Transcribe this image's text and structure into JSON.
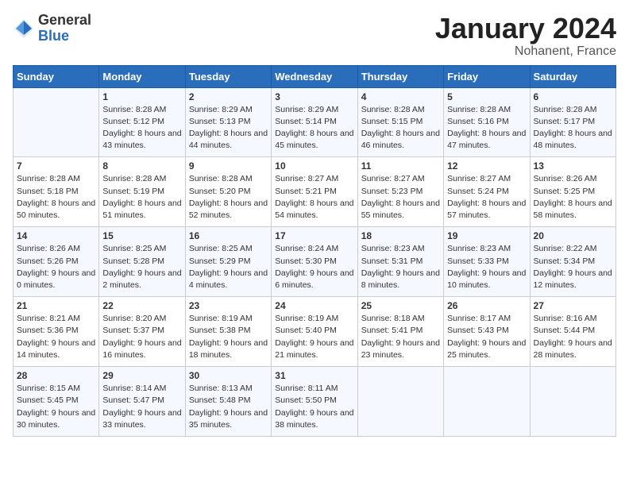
{
  "header": {
    "logo_general": "General",
    "logo_blue": "Blue",
    "month_title": "January 2024",
    "location": "Nohanent, France"
  },
  "days_of_week": [
    "Sunday",
    "Monday",
    "Tuesday",
    "Wednesday",
    "Thursday",
    "Friday",
    "Saturday"
  ],
  "weeks": [
    [
      {
        "day": "",
        "sunrise": "",
        "sunset": "",
        "daylight": ""
      },
      {
        "day": "1",
        "sunrise": "Sunrise: 8:28 AM",
        "sunset": "Sunset: 5:12 PM",
        "daylight": "Daylight: 8 hours and 43 minutes."
      },
      {
        "day": "2",
        "sunrise": "Sunrise: 8:29 AM",
        "sunset": "Sunset: 5:13 PM",
        "daylight": "Daylight: 8 hours and 44 minutes."
      },
      {
        "day": "3",
        "sunrise": "Sunrise: 8:29 AM",
        "sunset": "Sunset: 5:14 PM",
        "daylight": "Daylight: 8 hours and 45 minutes."
      },
      {
        "day": "4",
        "sunrise": "Sunrise: 8:28 AM",
        "sunset": "Sunset: 5:15 PM",
        "daylight": "Daylight: 8 hours and 46 minutes."
      },
      {
        "day": "5",
        "sunrise": "Sunrise: 8:28 AM",
        "sunset": "Sunset: 5:16 PM",
        "daylight": "Daylight: 8 hours and 47 minutes."
      },
      {
        "day": "6",
        "sunrise": "Sunrise: 8:28 AM",
        "sunset": "Sunset: 5:17 PM",
        "daylight": "Daylight: 8 hours and 48 minutes."
      }
    ],
    [
      {
        "day": "7",
        "sunrise": "Sunrise: 8:28 AM",
        "sunset": "Sunset: 5:18 PM",
        "daylight": "Daylight: 8 hours and 50 minutes."
      },
      {
        "day": "8",
        "sunrise": "Sunrise: 8:28 AM",
        "sunset": "Sunset: 5:19 PM",
        "daylight": "Daylight: 8 hours and 51 minutes."
      },
      {
        "day": "9",
        "sunrise": "Sunrise: 8:28 AM",
        "sunset": "Sunset: 5:20 PM",
        "daylight": "Daylight: 8 hours and 52 minutes."
      },
      {
        "day": "10",
        "sunrise": "Sunrise: 8:27 AM",
        "sunset": "Sunset: 5:21 PM",
        "daylight": "Daylight: 8 hours and 54 minutes."
      },
      {
        "day": "11",
        "sunrise": "Sunrise: 8:27 AM",
        "sunset": "Sunset: 5:23 PM",
        "daylight": "Daylight: 8 hours and 55 minutes."
      },
      {
        "day": "12",
        "sunrise": "Sunrise: 8:27 AM",
        "sunset": "Sunset: 5:24 PM",
        "daylight": "Daylight: 8 hours and 57 minutes."
      },
      {
        "day": "13",
        "sunrise": "Sunrise: 8:26 AM",
        "sunset": "Sunset: 5:25 PM",
        "daylight": "Daylight: 8 hours and 58 minutes."
      }
    ],
    [
      {
        "day": "14",
        "sunrise": "Sunrise: 8:26 AM",
        "sunset": "Sunset: 5:26 PM",
        "daylight": "Daylight: 9 hours and 0 minutes."
      },
      {
        "day": "15",
        "sunrise": "Sunrise: 8:25 AM",
        "sunset": "Sunset: 5:28 PM",
        "daylight": "Daylight: 9 hours and 2 minutes."
      },
      {
        "day": "16",
        "sunrise": "Sunrise: 8:25 AM",
        "sunset": "Sunset: 5:29 PM",
        "daylight": "Daylight: 9 hours and 4 minutes."
      },
      {
        "day": "17",
        "sunrise": "Sunrise: 8:24 AM",
        "sunset": "Sunset: 5:30 PM",
        "daylight": "Daylight: 9 hours and 6 minutes."
      },
      {
        "day": "18",
        "sunrise": "Sunrise: 8:23 AM",
        "sunset": "Sunset: 5:31 PM",
        "daylight": "Daylight: 9 hours and 8 minutes."
      },
      {
        "day": "19",
        "sunrise": "Sunrise: 8:23 AM",
        "sunset": "Sunset: 5:33 PM",
        "daylight": "Daylight: 9 hours and 10 minutes."
      },
      {
        "day": "20",
        "sunrise": "Sunrise: 8:22 AM",
        "sunset": "Sunset: 5:34 PM",
        "daylight": "Daylight: 9 hours and 12 minutes."
      }
    ],
    [
      {
        "day": "21",
        "sunrise": "Sunrise: 8:21 AM",
        "sunset": "Sunset: 5:36 PM",
        "daylight": "Daylight: 9 hours and 14 minutes."
      },
      {
        "day": "22",
        "sunrise": "Sunrise: 8:20 AM",
        "sunset": "Sunset: 5:37 PM",
        "daylight": "Daylight: 9 hours and 16 minutes."
      },
      {
        "day": "23",
        "sunrise": "Sunrise: 8:19 AM",
        "sunset": "Sunset: 5:38 PM",
        "daylight": "Daylight: 9 hours and 18 minutes."
      },
      {
        "day": "24",
        "sunrise": "Sunrise: 8:19 AM",
        "sunset": "Sunset: 5:40 PM",
        "daylight": "Daylight: 9 hours and 21 minutes."
      },
      {
        "day": "25",
        "sunrise": "Sunrise: 8:18 AM",
        "sunset": "Sunset: 5:41 PM",
        "daylight": "Daylight: 9 hours and 23 minutes."
      },
      {
        "day": "26",
        "sunrise": "Sunrise: 8:17 AM",
        "sunset": "Sunset: 5:43 PM",
        "daylight": "Daylight: 9 hours and 25 minutes."
      },
      {
        "day": "27",
        "sunrise": "Sunrise: 8:16 AM",
        "sunset": "Sunset: 5:44 PM",
        "daylight": "Daylight: 9 hours and 28 minutes."
      }
    ],
    [
      {
        "day": "28",
        "sunrise": "Sunrise: 8:15 AM",
        "sunset": "Sunset: 5:45 PM",
        "daylight": "Daylight: 9 hours and 30 minutes."
      },
      {
        "day": "29",
        "sunrise": "Sunrise: 8:14 AM",
        "sunset": "Sunset: 5:47 PM",
        "daylight": "Daylight: 9 hours and 33 minutes."
      },
      {
        "day": "30",
        "sunrise": "Sunrise: 8:13 AM",
        "sunset": "Sunset: 5:48 PM",
        "daylight": "Daylight: 9 hours and 35 minutes."
      },
      {
        "day": "31",
        "sunrise": "Sunrise: 8:11 AM",
        "sunset": "Sunset: 5:50 PM",
        "daylight": "Daylight: 9 hours and 38 minutes."
      },
      {
        "day": "",
        "sunrise": "",
        "sunset": "",
        "daylight": ""
      },
      {
        "day": "",
        "sunrise": "",
        "sunset": "",
        "daylight": ""
      },
      {
        "day": "",
        "sunrise": "",
        "sunset": "",
        "daylight": ""
      }
    ]
  ]
}
